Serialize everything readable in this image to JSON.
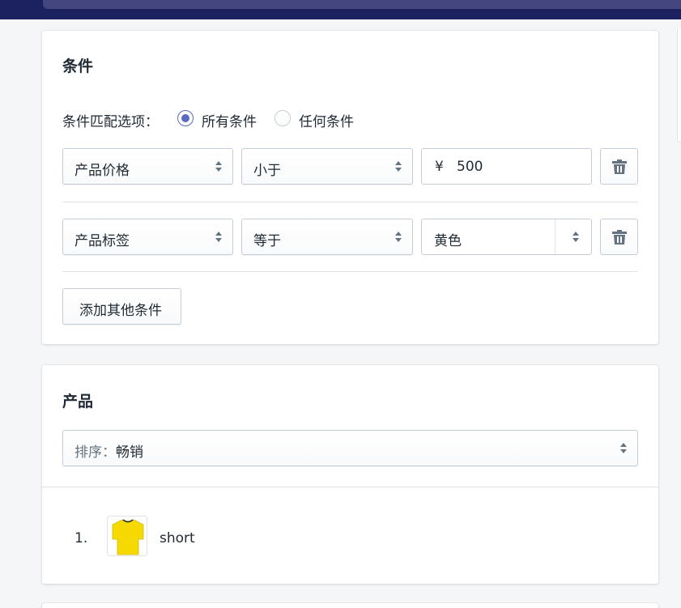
{
  "conditions": {
    "title": "条件",
    "match_label": "条件匹配选项：",
    "match_options": [
      {
        "label": "所有条件",
        "checked": true
      },
      {
        "label": "任何条件",
        "checked": false
      }
    ],
    "rows": [
      {
        "field": "产品价格",
        "operator": "小于",
        "currency": "¥",
        "value": "500"
      },
      {
        "field": "产品标签",
        "operator": "等于",
        "value": "黄色"
      }
    ],
    "add_button": "添加其他条件"
  },
  "products": {
    "title": "产品",
    "sort_prefix": "排序：",
    "sort_value": "畅销",
    "items": [
      {
        "index": "1.",
        "name": "short",
        "thumbnail_icon": "yellow-tshirt"
      }
    ]
  },
  "colors": {
    "accent": "#5c6ac4",
    "topbar": "#1c2260",
    "shirt": "#f5d900"
  }
}
